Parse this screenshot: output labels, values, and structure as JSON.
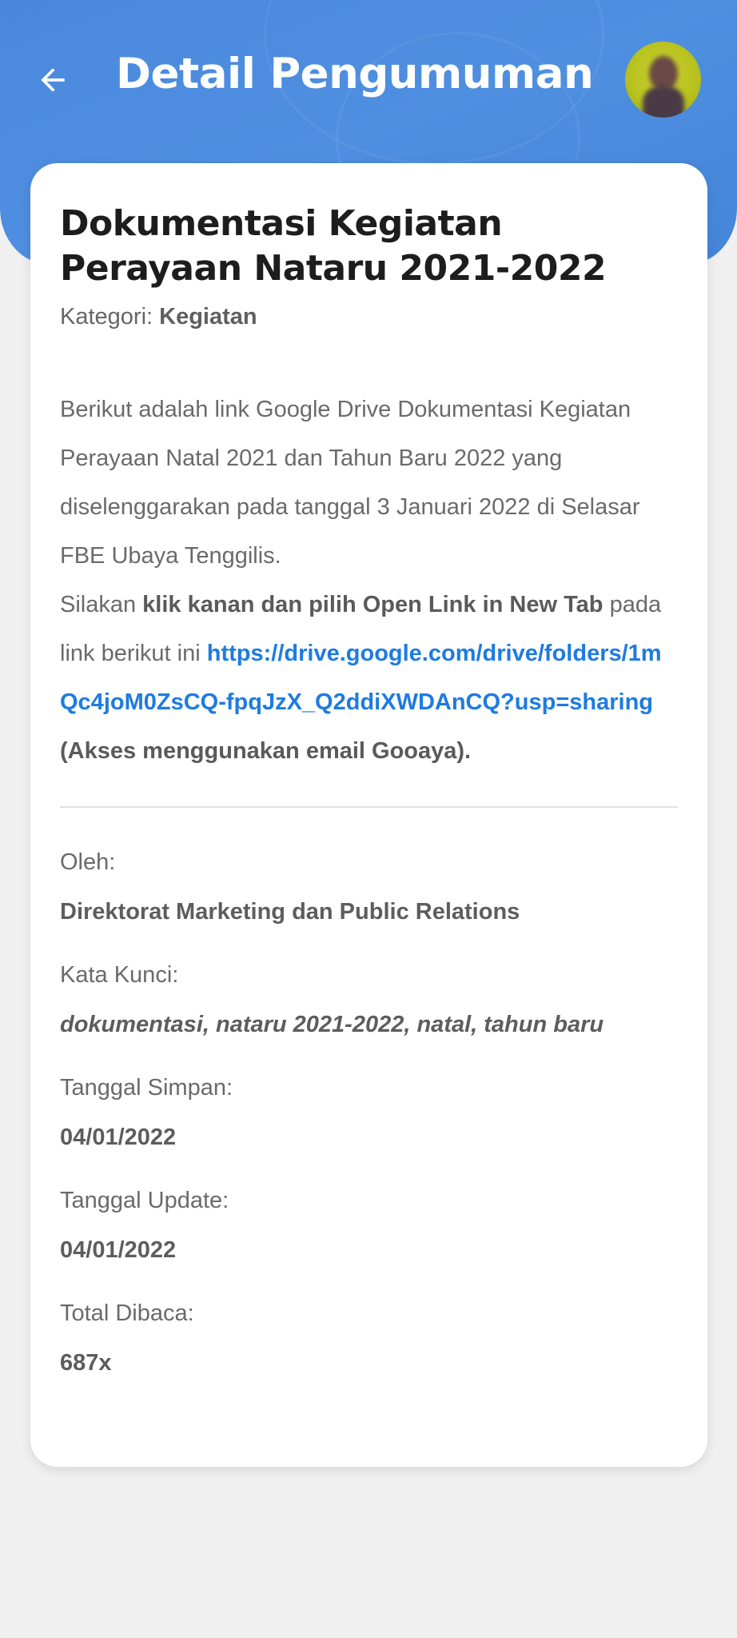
{
  "header": {
    "title": "Detail Pengumuman",
    "back_icon": "arrow-left-icon",
    "color": "#4a88dc"
  },
  "announcement": {
    "title": "Dokumentasi Kegiatan Perayaan Nataru 2021-2022",
    "category_label": "Kategori:",
    "category_value": "Kegiatan",
    "body": {
      "p1": "Berikut adalah link Google Drive Dokumentasi Kegiatan Perayaan Natal 2021 dan Tahun Baru 2022 yang diselenggarakan pada tanggal 3 Januari 2022 di Selasar FBE Ubaya Tenggilis.",
      "p2_prefix": "Silakan ",
      "p2_bold": "klik kanan dan pilih Open Link in New Tab",
      "p2_suffix": " pada link berikut ini ",
      "link": "https://drive.google.com/drive/folders/1mQc4joM0ZsCQ-fpqJzX_Q2ddiXWDAnCQ?usp=sharing",
      "link_note": " (Akses menggunakan email Gooaya)."
    },
    "link_color": "#1e7be0"
  },
  "meta": {
    "author_label": "Oleh:",
    "author_value": "Direktorat Marketing dan Public Relations",
    "keywords_label": "Kata Kunci:",
    "keywords_value": "dokumentasi, nataru 2021-2022, natal, tahun baru",
    "saved_label": "Tanggal Simpan:",
    "saved_value": "04/01/2022",
    "updated_label": "Tanggal Update:",
    "updated_value": "04/01/2022",
    "reads_label": "Total Dibaca:",
    "reads_value": "687x"
  }
}
